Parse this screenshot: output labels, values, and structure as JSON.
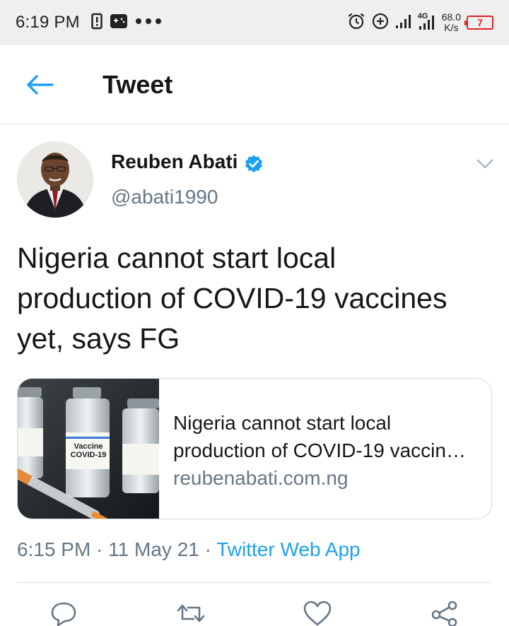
{
  "status_bar": {
    "time": "6:19 PM",
    "network_type": "4G",
    "speed_value": "68.0",
    "speed_unit": "K/s",
    "battery": "7",
    "icons": [
      "alert-icon",
      "gamepad-icon",
      "more-dots-icon",
      "alarm-icon",
      "data-saver-icon",
      "signal-icon",
      "signal-4g-icon",
      "battery-icon"
    ]
  },
  "appbar": {
    "title": "Tweet",
    "back_icon": "back-arrow-icon"
  },
  "tweet": {
    "author_name": "Reuben Abati",
    "handle": "@abati1990",
    "verified": true,
    "text_lines": [
      "Nigeria cannot start local",
      "production of COVID-19 vaccines",
      "yet, says FG"
    ],
    "card": {
      "title_line1": "Nigeria cannot start local",
      "title_line2": "production of COVID-19 vaccin…",
      "domain": "reubenabati.com.ng",
      "image_labels": [
        "Vaccine",
        "COVID-19"
      ]
    },
    "time": "6:15 PM",
    "separator": "·",
    "date": "11 May 21",
    "source": "Twitter Web App"
  },
  "actions": [
    "reply-icon",
    "retweet-icon",
    "like-icon",
    "share-icon"
  ],
  "colors": {
    "accent": "#1da1f2",
    "secondary_text": "#657786",
    "primary_text": "#14171a",
    "battery_low": "#e0242c"
  }
}
